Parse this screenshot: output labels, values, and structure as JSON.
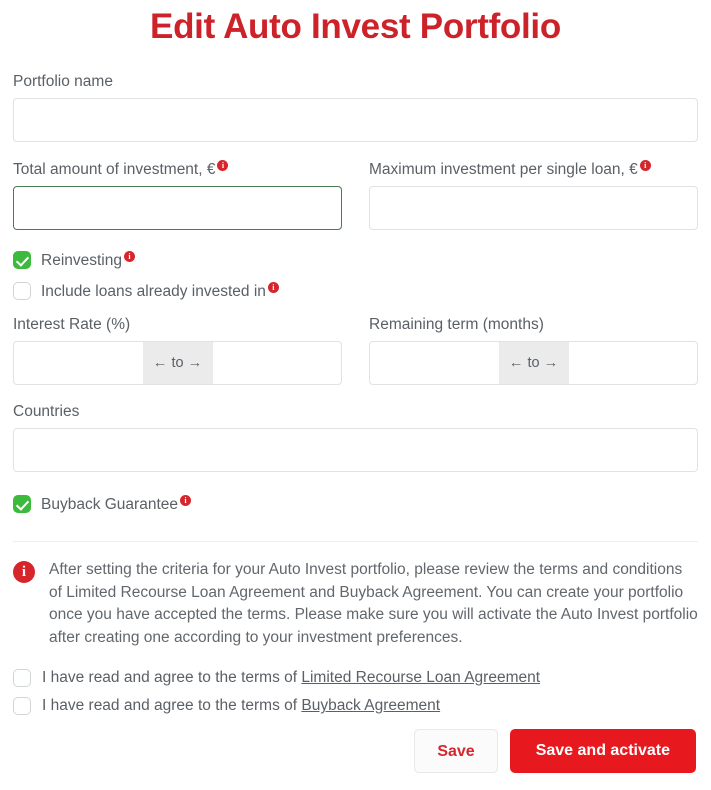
{
  "header": {
    "title": "Edit Auto Invest Portfolio",
    "title_color": "#cc2229"
  },
  "form": {
    "portfolio_name": {
      "label": "Portfolio name",
      "value": "",
      "placeholder": ""
    },
    "total_amount": {
      "label": "Total amount of investment, €",
      "info_badge": "i",
      "value": "",
      "placeholder": "",
      "focused": true,
      "focus_border_color": "#4a7a52"
    },
    "max_per_loan": {
      "label": "Maximum investment per single loan, €",
      "info_badge": "i",
      "value": "",
      "placeholder": ""
    },
    "reinvesting": {
      "label": "Reinvesting",
      "checked": true,
      "info_badge": "i"
    },
    "include_existing": {
      "label": "Include loans already invested in",
      "checked": false,
      "info_badge": "i"
    },
    "interest_rate": {
      "label": "Interest Rate (%)",
      "separator": "← to →",
      "from_value": "",
      "to_value": ""
    },
    "remaining_term": {
      "label": "Remaining term (months)",
      "separator": "← to →",
      "from_value": "",
      "to_value": ""
    },
    "countries": {
      "label": "Countries",
      "value": "",
      "placeholder": ""
    },
    "buyback_guarantee": {
      "label": "Buyback Guarantee",
      "checked": true,
      "info_badge": "i"
    }
  },
  "notice": {
    "icon": "i",
    "icon_color": "#d6262c",
    "text": "After setting the criteria for your Auto Invest portfolio, please review the terms and conditions of Limited Recourse Loan Agreement and Buyback Agreement. You can create your portfolio once you have accepted the terms. Please make sure you will activate the Auto Invest portfolio after creating one according to your investment preferences."
  },
  "agreements": [
    {
      "checked": false,
      "text": "I have read and agree to the terms of ",
      "link": "Limited Recourse Loan Agreement"
    },
    {
      "checked": false,
      "text": "I have read and agree to the terms of ",
      "link": "Buyback Agreement"
    }
  ],
  "buttons": {
    "save": "Save",
    "save_and_activate": "Save and activate",
    "primary_color": "#e7191f",
    "secondary_text_color": "#d6262c"
  }
}
